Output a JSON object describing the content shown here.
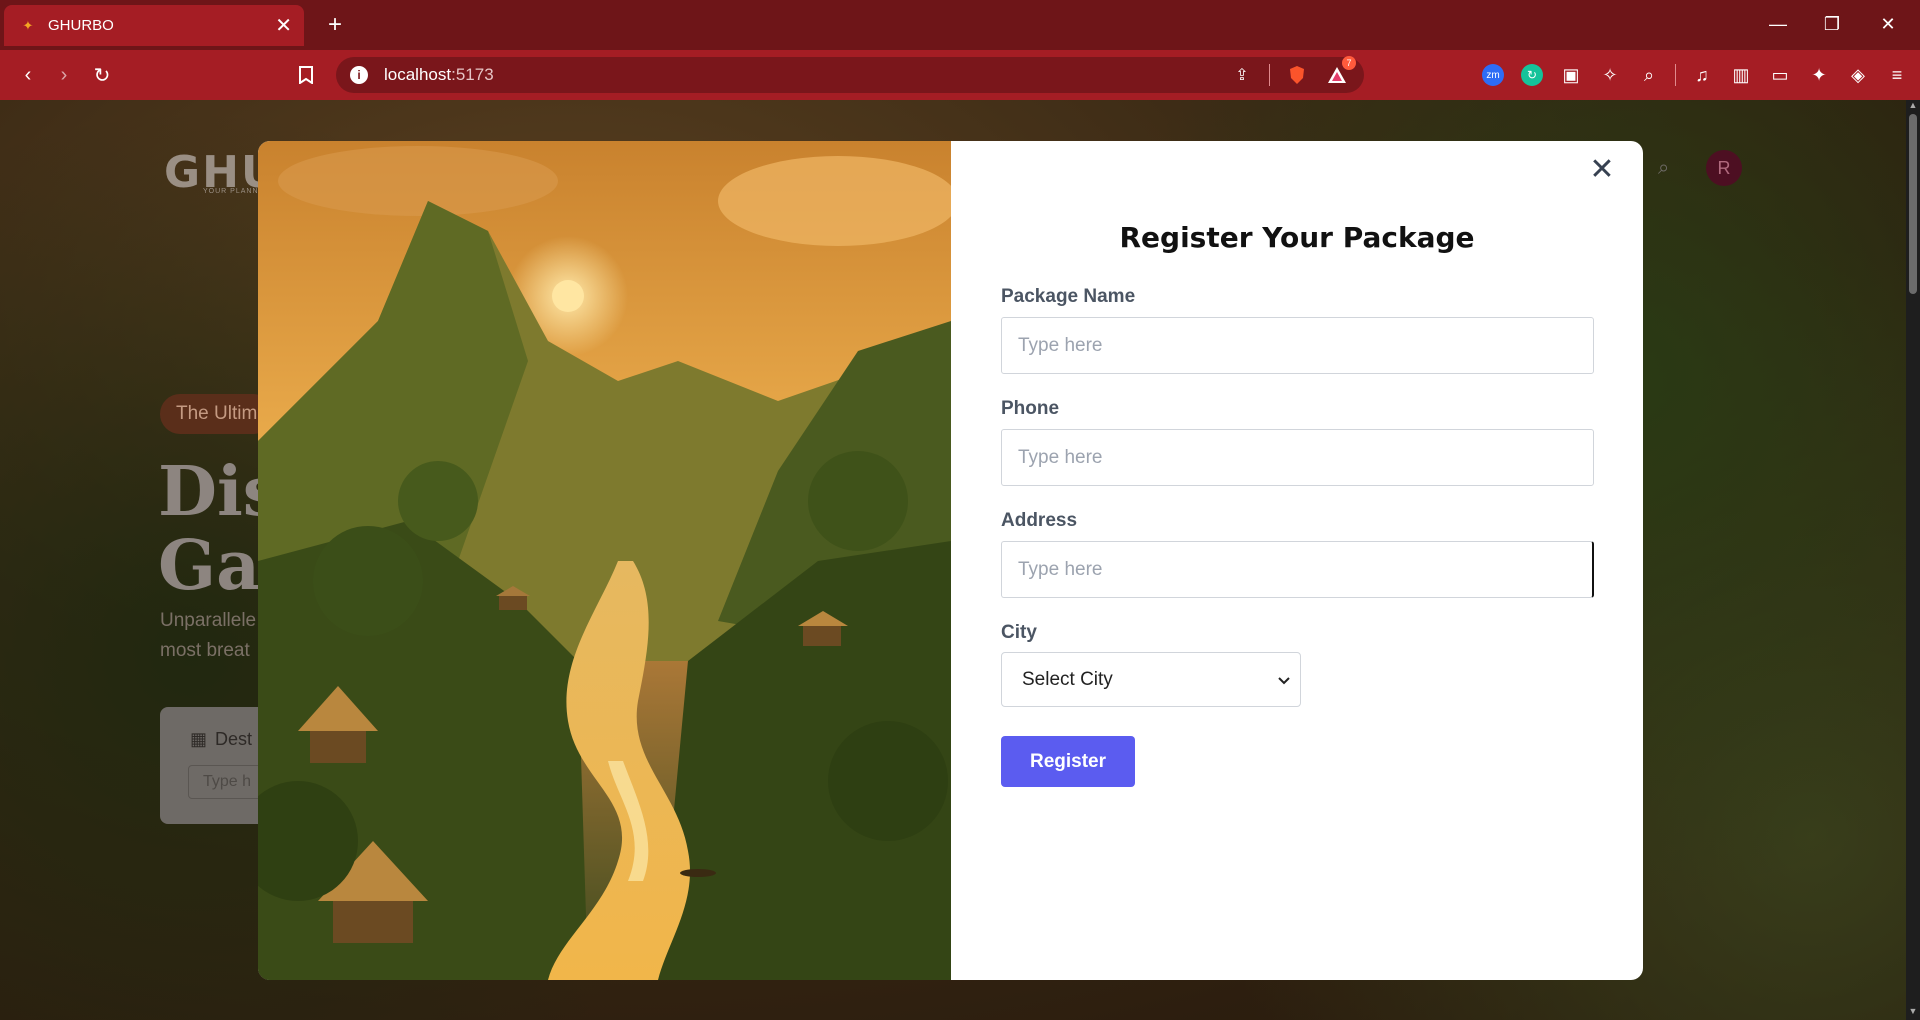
{
  "browser": {
    "tab_title": "GHURBO",
    "url_host": "localhost",
    "url_port": ":5173",
    "notification_count": "7"
  },
  "background_page": {
    "logo": "GHURBO",
    "logo_tagline": "YOUR PLANNING",
    "pill_text": "The Ultim",
    "headline_line1": "Dis",
    "headline_line2": "Gat",
    "subtitle_line1": "Unparallele",
    "subtitle_line2": "most breat",
    "card_label": "Dest",
    "card_input_placeholder": "Type h",
    "avatar_initial": "R"
  },
  "modal": {
    "title": "Register Your Package",
    "fields": [
      {
        "label": "Package Name",
        "placeholder": "Type here"
      },
      {
        "label": "Phone",
        "placeholder": "Type here"
      },
      {
        "label": "Address",
        "placeholder": "Type here"
      }
    ],
    "city_label": "City",
    "city_selected": "Select City",
    "register_label": "Register"
  },
  "colors": {
    "browser_tabbar": "#6e1518",
    "browser_toolbar": "#a51d24",
    "accent_button": "#5b5cf0"
  }
}
